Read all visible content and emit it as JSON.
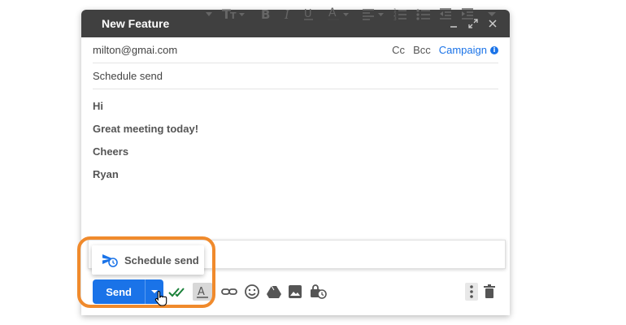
{
  "window": {
    "title": "New Feature"
  },
  "recipients": {
    "to": "milton@gmai.com",
    "cc": "Cc",
    "bcc": "Bcc",
    "campaign": "Campaign",
    "info": "i"
  },
  "subject": "Schedule send",
  "body": {
    "lines": [
      "Hi",
      "Great meeting today!",
      "Cheers",
      "Ryan"
    ]
  },
  "popup": {
    "schedule_send_label": "Schedule send"
  },
  "send": {
    "label": "Send"
  },
  "colors": {
    "accent": "#1a73e8",
    "highlight": "#f08a2c",
    "titlebar": "#404040",
    "check": "#188038"
  }
}
